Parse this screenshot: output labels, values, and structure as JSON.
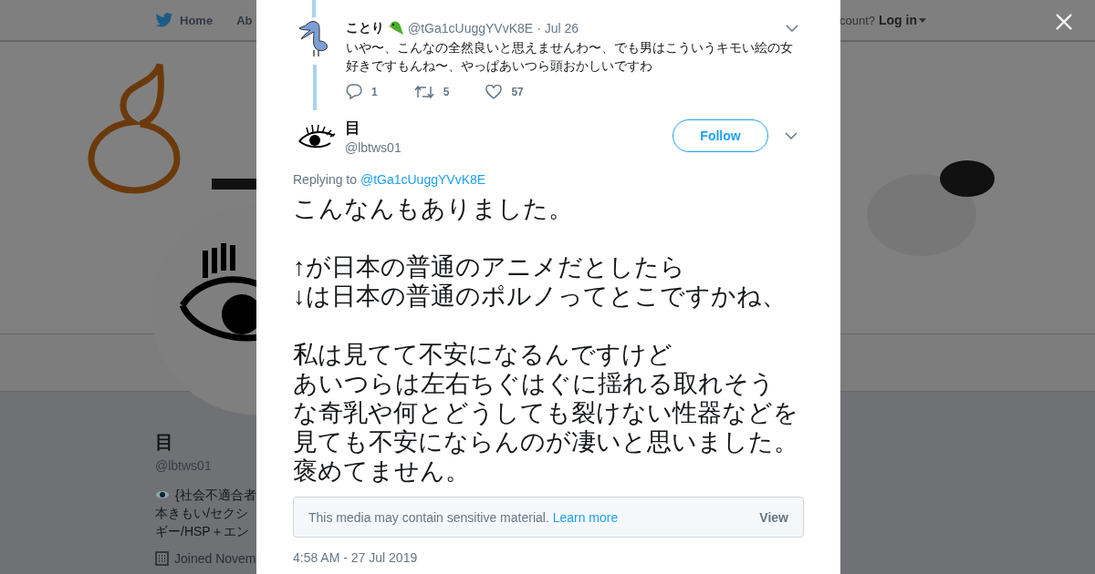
{
  "nav": {
    "items": [
      {
        "label": "Home",
        "kind": "bird"
      },
      {
        "label": "Ab",
        "kind": "plain"
      }
    ],
    "account_prompt": "count?",
    "login": "Log in"
  },
  "profile": {
    "name": "目",
    "handle": "@lbtws01",
    "bio_lines": [
      "{社会不適合者",
      "本きもい/セクシ",
      "ギー/HSP＋エン"
    ],
    "joined": "Joined Novem"
  },
  "reply_tweet": {
    "name": "ことり",
    "handle": "@tGa1cUuggYVvK8E",
    "date": "· Jul 26",
    "text": "いや〜、こんなの全然良いと思えませんわ〜、でも男はこういうキモい絵の女好きですもんね〜、やっぱあいつら頭おかしいですわ",
    "actions": [
      {
        "kind": "reply",
        "count": "1"
      },
      {
        "kind": "retweet",
        "count": "5"
      },
      {
        "kind": "like",
        "count": "57"
      }
    ]
  },
  "main_tweet": {
    "name": "目",
    "handle": "@lbtws01",
    "follow": "Follow",
    "replying_prefix": "Replying to",
    "replying_to": "@tGa1cUuggYVvK8E",
    "paragraphs": [
      [
        "こんなんもありました。"
      ],
      [
        "↑が日本の普通のアニメだとしたら",
        "↓は日本の普通のポルノってとこですかね、"
      ],
      [
        "私は見てて不安になるんですけど",
        "あいつらは左右ちぐはぐに揺れる取れそう",
        "な奇乳や何とどうしても裂けない性器などを",
        "見ても不安にならんのが凄いと思いました。",
        "褒めてません。"
      ]
    ],
    "sensitive_notice": "This media may contain sensitive material.",
    "learn_more": "Learn more",
    "view": "View",
    "timestamp": "4:58 AM - 27 Jul 2019"
  }
}
